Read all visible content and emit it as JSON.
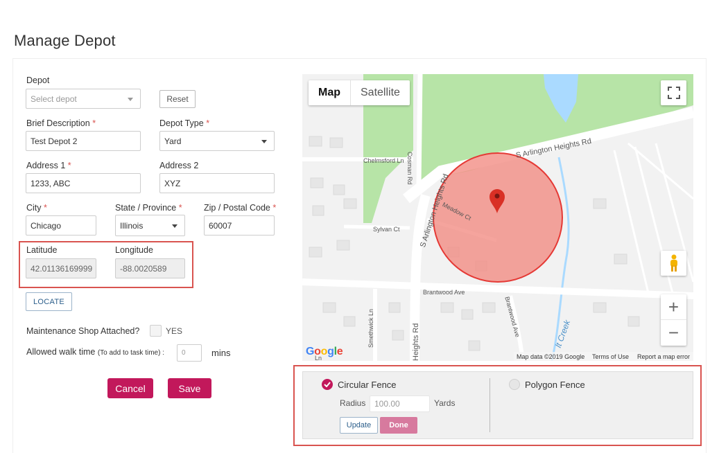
{
  "page": {
    "title": "Manage Depot"
  },
  "form": {
    "depot": {
      "label": "Depot",
      "placeholder": "Select depot"
    },
    "reset_label": "Reset",
    "brief_description": {
      "label": "Brief Description",
      "required": "*",
      "value": "Test Depot 2"
    },
    "depot_type": {
      "label": "Depot Type",
      "required": "*",
      "value": "Yard"
    },
    "address1": {
      "label": "Address 1",
      "required": "*",
      "value": "1233, ABC"
    },
    "address2": {
      "label": "Address 2",
      "value": "XYZ"
    },
    "city": {
      "label": "City",
      "required": "*",
      "value": "Chicago"
    },
    "state": {
      "label": "State / Province",
      "required": "*",
      "value": "Illinois"
    },
    "zip": {
      "label": "Zip / Postal Code",
      "required": "*",
      "value": "60007"
    },
    "latitude": {
      "label": "Latitude",
      "value": "42.01136169999"
    },
    "longitude": {
      "label": "Longitude",
      "value": "-88.0020589"
    },
    "locate_label": "LOCATE",
    "maintenance": {
      "label": "Maintenance Shop Attached?",
      "option": "YES"
    },
    "walk_time": {
      "label": "Allowed walk time",
      "hint": "(To add to task time) :",
      "placeholder": "0",
      "unit": "mins"
    },
    "cancel_label": "Cancel",
    "save_label": "Save"
  },
  "map": {
    "tabs": [
      "Map",
      "Satellite"
    ],
    "streets": {
      "arlington_heights_rd": "S Arlington Heights Rd",
      "arlington_heights_rd_vertical": "S Arlington Heights Rd",
      "chelmsford": "Chelmsford Ln",
      "cosman": "Cosman Rd",
      "meadow": "Meadow Ct",
      "sylvan": "Sylvan Ct",
      "brantwood": "Brantwood Ave",
      "brantwood2": "Brantwood Ave",
      "smethwick": "Smethwick Ln",
      "heights_rd": "Heights Rd",
      "creek": "lt Creek",
      "ln_partial": "Ln"
    },
    "footer": {
      "data": "Map data ©2019 Google",
      "terms": "Terms of Use",
      "report": "Report a map error"
    },
    "google_logo": "Google",
    "zoom_in": "+",
    "zoom_out": "−"
  },
  "fence": {
    "circular_label": "Circular Fence",
    "polygon_label": "Polygon Fence",
    "radius_label": "Radius",
    "radius_value": "100.00",
    "radius_unit": "Yards",
    "update_label": "Update",
    "done_label": "Done"
  },
  "colors": {
    "accent": "#c2185b",
    "highlight": "#d9534f",
    "fence_fill": "#f28b82",
    "park": "#b7e4a7",
    "water": "#aadaff"
  }
}
